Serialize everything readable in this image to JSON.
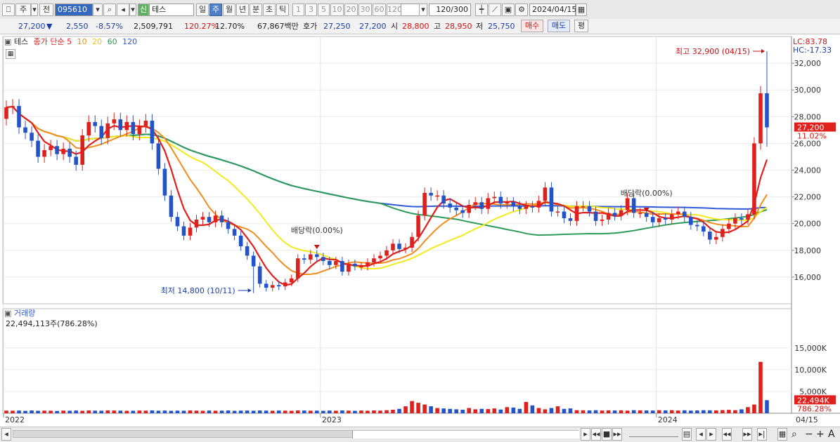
{
  "toolbar": {
    "market_label": "주",
    "prev_label": "전",
    "code": "095610",
    "name_badge": "신",
    "name": "테스",
    "period_tabs": [
      "일",
      "주",
      "월",
      "년",
      "분",
      "초",
      "틱"
    ],
    "selected_period": "주",
    "interval_buttons": [
      "1",
      "3",
      "5",
      "10",
      "20",
      "30",
      "60",
      "120"
    ],
    "count": "120/300",
    "date": "2024/04/15"
  },
  "quote": {
    "price": "27,200",
    "change_arrow": "▼",
    "change": "2,550",
    "change_pct": "-8.57%",
    "volume": "2,509,791",
    "volume_ratio": "120.27%",
    "turnover": "12.70%",
    "amount": "67,867백만",
    "bid_label": "호가",
    "bid1": "27,250",
    "bid2": "27,200",
    "open_label": "시",
    "open": "28,800",
    "high_label": "고",
    "high": "28,950",
    "low_label": "저",
    "low": "25,750",
    "buy_label": "매수",
    "sell_label": "매도",
    "avg_label": "평"
  },
  "colors": {
    "up": "#e0201d",
    "down": "#2353c9",
    "ma5": "#e0201d",
    "ma10": "#f28d1c",
    "ma20": "#f2ea1c",
    "ma60": "#2e9a58",
    "ma120": "#2e5ad6"
  },
  "chart_data": [
    {
      "type": "candlestick",
      "legend": {
        "name": "테스",
        "label": "종가 단순",
        "periods": [
          "5",
          "10",
          "20",
          "60",
          "120"
        ]
      },
      "ylim": [
        14000,
        34000
      ],
      "yticks": [
        "32,000",
        "30,000",
        "28,000",
        "26,000",
        "24,000",
        "22,000",
        "20,000",
        "18,000",
        "16,000"
      ],
      "xticks": [
        "2022",
        "2023",
        "2024"
      ],
      "last_date_label": "04/15",
      "lc_label": "LC:83.78",
      "hc_label": "HC:-17.33",
      "current_price_label": "27,200",
      "current_pct_label": "11.02%",
      "annotations": {
        "high": "최고 32,900 (04/15)",
        "low": "최저 14,800 (10/11)",
        "dividend_1": "배당락(0.00%)",
        "dividend_2": "배당락(0.00%)"
      },
      "closes": [
        28700,
        28800,
        27200,
        26800,
        26200,
        25000,
        25500,
        25800,
        25200,
        25600,
        25000,
        24400,
        26600,
        27600,
        27300,
        26400,
        27500,
        27800,
        27000,
        27600,
        26700,
        27300,
        27700,
        26000,
        24100,
        22100,
        20500,
        19800,
        19100,
        19700,
        20300,
        20500,
        20100,
        20600,
        20100,
        19600,
        19100,
        18300,
        17600,
        16800,
        15500,
        15200,
        15400,
        15300,
        15600,
        15900,
        17400,
        17300,
        17700,
        17500,
        17200,
        16900,
        17200,
        16400,
        17000,
        16800,
        16800,
        17100,
        17400,
        17600,
        18000,
        18500,
        18100,
        18200,
        19000,
        20600,
        22300,
        22100,
        22100,
        21500,
        21200,
        21000,
        20800,
        21400,
        21600,
        21100,
        21900,
        22000,
        21500,
        21600,
        21300,
        21100,
        21300,
        21200,
        21700,
        22700,
        20900,
        20900,
        20400,
        20200,
        21300,
        21300,
        20900,
        20200,
        20300,
        20800,
        20600,
        21000,
        21900,
        20800,
        20800,
        20500,
        20100,
        20400,
        20300,
        20700,
        20900,
        20500,
        19900,
        19800,
        19400,
        18800,
        19000,
        19600,
        20000,
        20400,
        20300,
        20700,
        26000,
        29750,
        27200
      ],
      "volume_label": "거래량",
      "volume_info": "22,494,113주(786.28%)",
      "volume_ylim": [
        0,
        24000
      ],
      "volume_ticks": [
        "15,000K",
        "10,000K",
        "5,000K"
      ],
      "volume_current_label": "22,494K",
      "volume_current_pct": "786.28%",
      "volumes": [
        600,
        580,
        620,
        550,
        640,
        560,
        600,
        580,
        520,
        600,
        580,
        620,
        560,
        640,
        600,
        580,
        660,
        620,
        600,
        560,
        580,
        620,
        600,
        640,
        580,
        620,
        560,
        600,
        580,
        640,
        600,
        560,
        620,
        580,
        600,
        640,
        560,
        600,
        620,
        580,
        640,
        600,
        580,
        620,
        600,
        560,
        640,
        620,
        580,
        600,
        560,
        620,
        580,
        640,
        600,
        560,
        620,
        580,
        640,
        600,
        700,
        800,
        1000,
        1600,
        2800,
        2400,
        2000,
        1600,
        1200,
        1100,
        1000,
        900,
        800,
        1200,
        900,
        1000,
        950,
        1100,
        850,
        1400,
        1300,
        1000,
        2600,
        1800,
        1200,
        900,
        1200,
        1600,
        1000,
        1100,
        700,
        680,
        650,
        700,
        620,
        660,
        640,
        680,
        600,
        700,
        660,
        640,
        620,
        700,
        660,
        700,
        620,
        680,
        600,
        640,
        700,
        680,
        660,
        720,
        780,
        700,
        900,
        1400,
        2000,
        11800,
        3000,
        22494
      ]
    }
  ],
  "footer": {
    "date_label": "04/15"
  }
}
